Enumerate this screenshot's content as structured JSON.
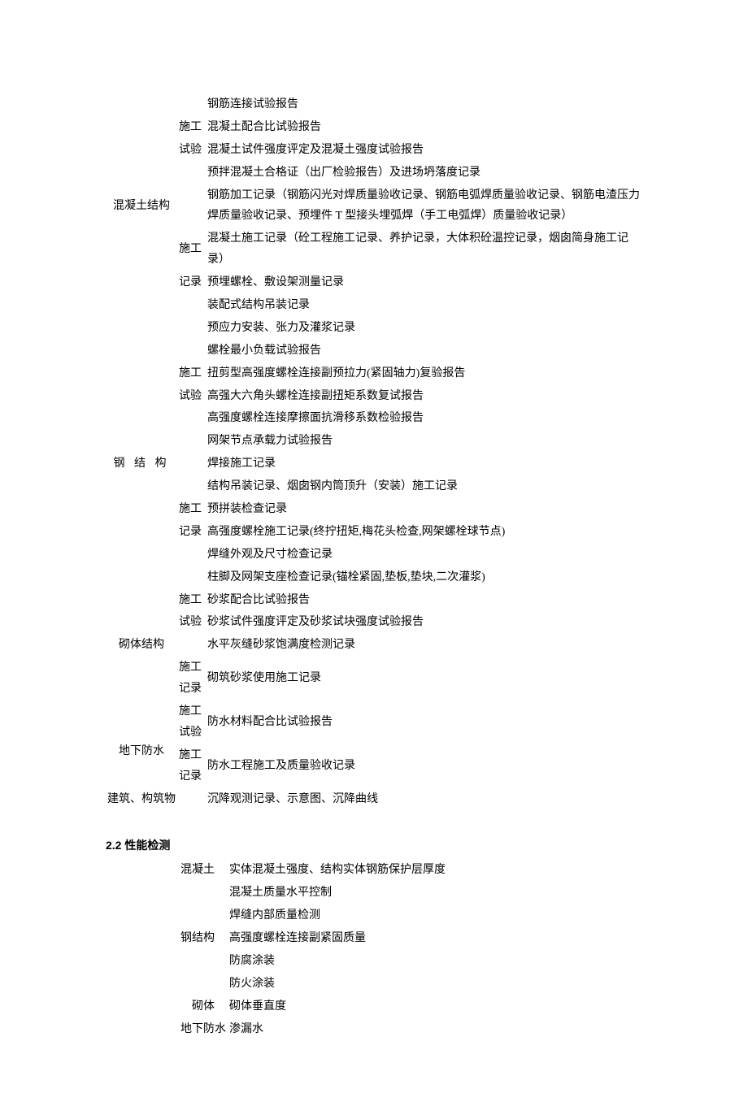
{
  "section1": {
    "groups": [
      {
        "category": "混凝土结构",
        "subgroups": [
          {
            "label": "施工试验",
            "items": [
              "钢筋连接试验报告",
              "混凝土配合比试验报告",
              "混凝土试件强度评定及混凝土强度试验报告",
              "预拌混凝土合格证（出厂检验报告）及进场坍落度记录"
            ]
          },
          {
            "label": "施工记录",
            "items": [
              "钢筋加工记录（钢筋闪光对焊质量验收记录、钢筋电弧焊质量验收记录、钢筋电渣压力焊质量验收记录、预埋件 T 型接头埋弧焊（手工电弧焊）质量验收记录）",
              "混凝土施工记录（砼工程施工记录、养护记录，大体积砼温控记录，烟囱简身施工记录）",
              "预埋螺栓、敷设架测量记录",
              "装配式结构吊装记录",
              "预应力安装、张力及灌浆记录"
            ]
          }
        ]
      },
      {
        "category": "钢 结 构",
        "subgroups": [
          {
            "label": "施工试验",
            "items": [
              "螺栓最小负载试验报告",
              "扭剪型高强度螺栓连接副预拉力(紧固轴力)复验报告",
              "高强大六角头螺栓连接副扭矩系数复试报告",
              "高强度螺栓连接摩擦面抗滑移系数检验报告",
              "网架节点承载力试验报告"
            ]
          },
          {
            "label": "施工记录",
            "items": [
              "焊接施工记录",
              "结构吊装记录、烟囱钢内筒顶升（安装）施工记录",
              "预拼装检查记录",
              "高强度螺栓施工记录(终拧扭矩,梅花头检查,网架螺栓球节点)",
              "焊缝外观及尺寸检查记录",
              "柱脚及网架支座检查记录(锚栓紧固,垫板,垫块,二次灌浆)"
            ]
          }
        ]
      },
      {
        "category": "砌体结构",
        "subgroups": [
          {
            "label": "施工试验",
            "items": [
              "砂浆配合比试验报告",
              "砂浆试件强度评定及砂浆试块强度试验报告",
              "水平灰缝砂浆饱满度检测记录"
            ]
          },
          {
            "label": "施工记录",
            "items": [
              "砌筑砂浆使用施工记录"
            ]
          }
        ]
      },
      {
        "category": "地下防水",
        "subgroups": [
          {
            "label": "施工试验",
            "items": [
              "防水材料配合比试验报告"
            ]
          },
          {
            "label": "施工记录",
            "items": [
              "防水工程施工及质量验收记录"
            ]
          }
        ]
      },
      {
        "category": "建筑、构筑物",
        "subgroups": [
          {
            "label": "",
            "items": [
              "沉降观测记录、示意图、沉降曲线"
            ]
          }
        ]
      }
    ]
  },
  "section2": {
    "heading": "2.2 性能检测",
    "groups": [
      {
        "category": "混凝土",
        "items": [
          "实体混凝土强度、结构实体钢筋保护层厚度",
          "混凝土质量水平控制"
        ]
      },
      {
        "category": "钢结构",
        "items": [
          "焊缝内部质量检测",
          "高强度螺栓连接副紧固质量",
          "防腐涂装",
          "防火涂装"
        ]
      },
      {
        "category": "砌体",
        "items": [
          "砌体垂直度"
        ]
      },
      {
        "category": "地下防水",
        "items": [
          "渗漏水"
        ]
      }
    ]
  }
}
